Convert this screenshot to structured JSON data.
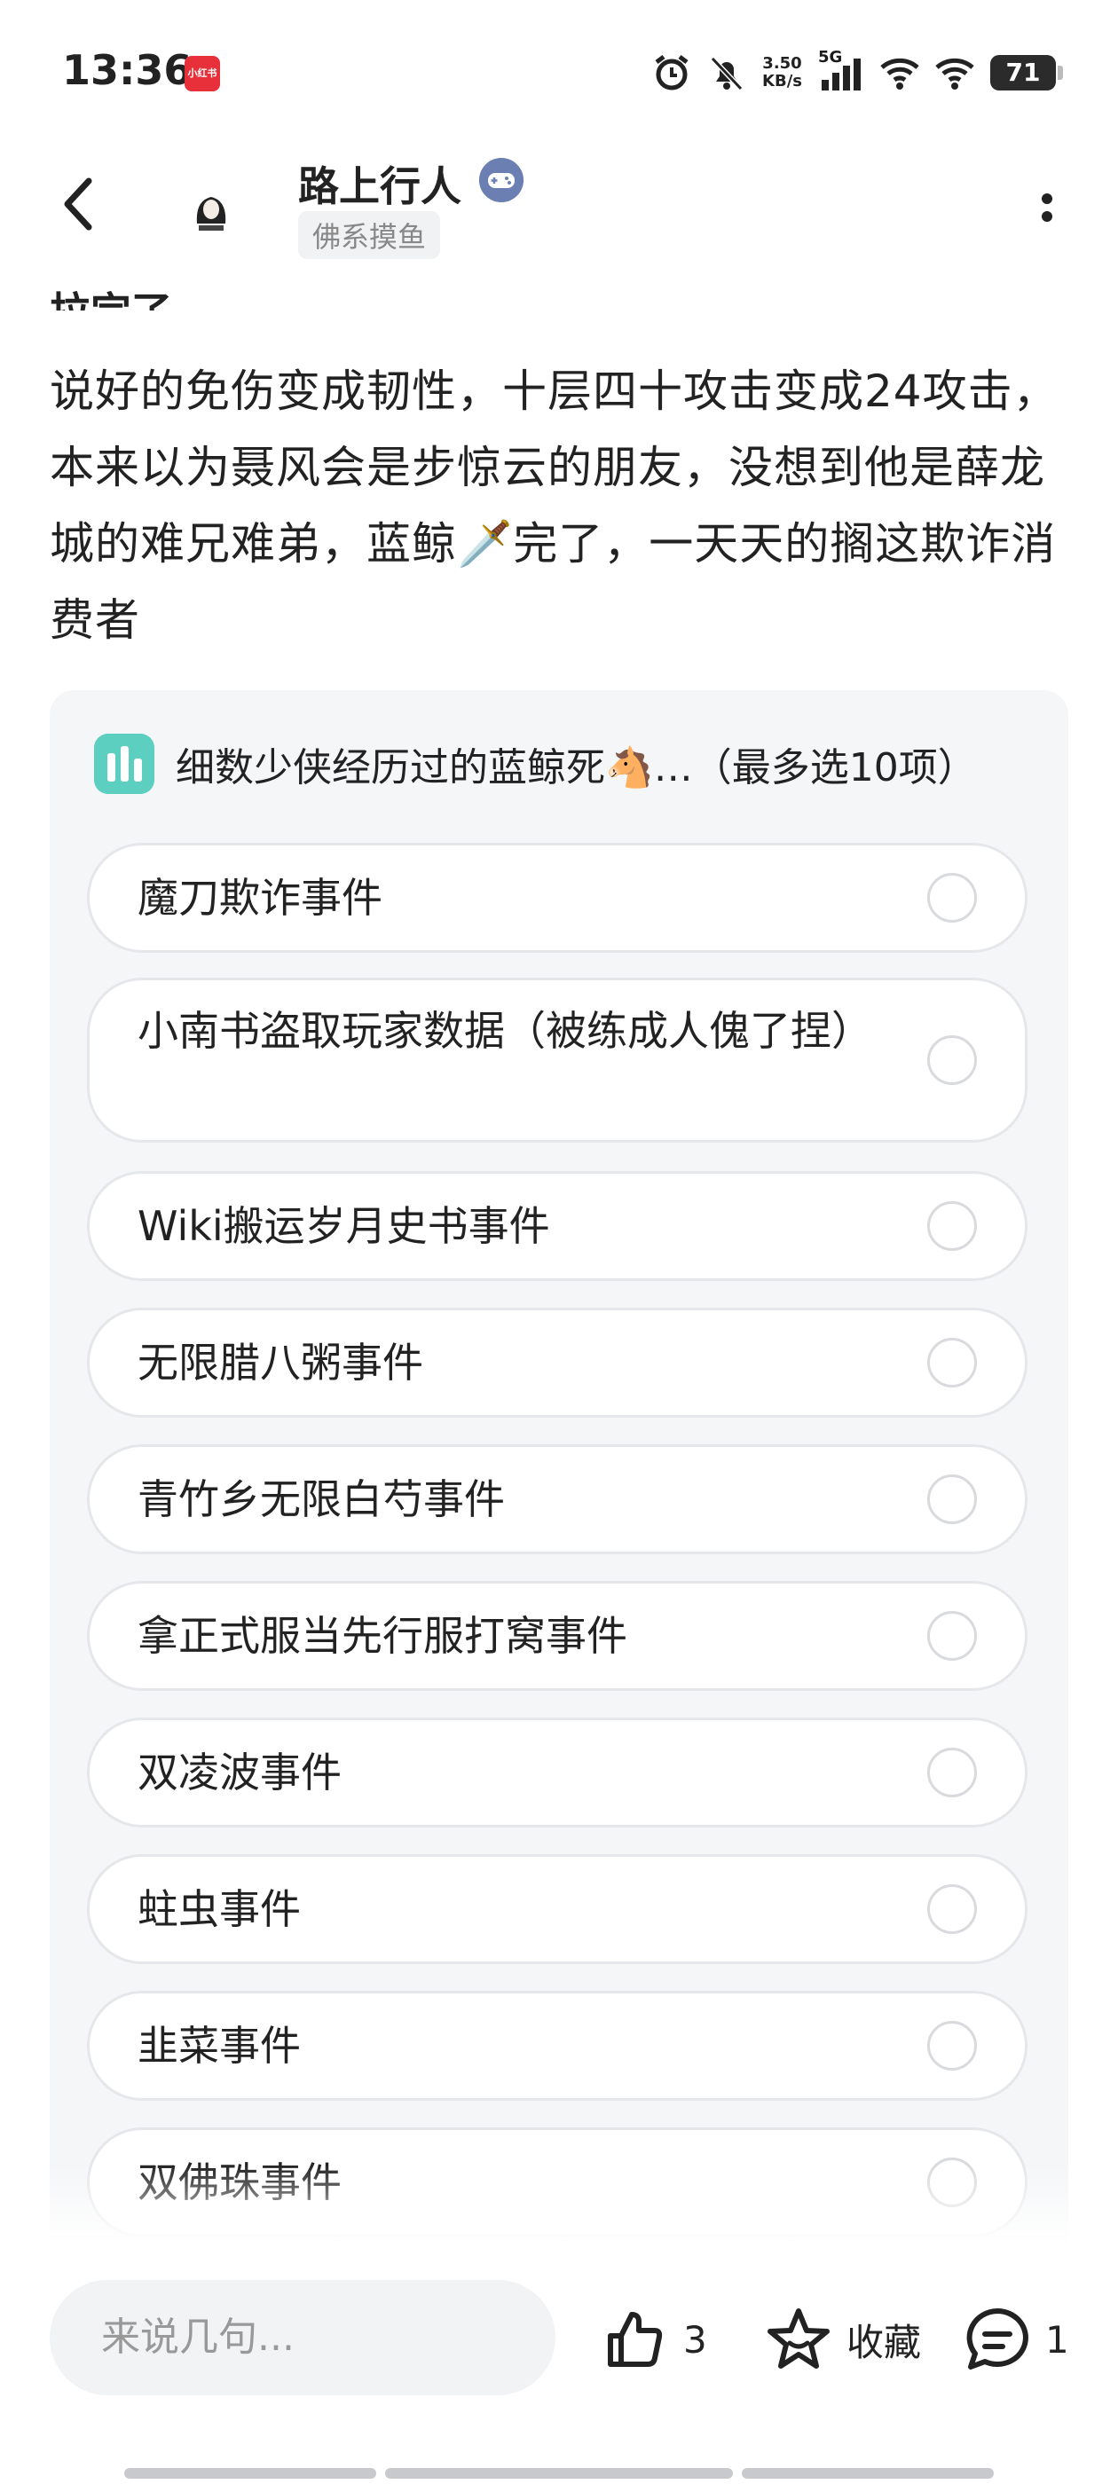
{
  "status_bar": {
    "time": "13:36",
    "app_badge": "小红书",
    "net_speed_value": "3.50",
    "net_speed_unit": "KB/s",
    "network": "5G",
    "battery": "71"
  },
  "header": {
    "username": "路上行人",
    "tag": "佛系摸鱼"
  },
  "post": {
    "cut_title": "拉完了",
    "body": "说好的免伤变成韧性，十层四十攻击变成24攻击，本来以为聂风会是步惊云的朋友，没想到他是薛龙城的难兄难弟，蓝鲸🗡️完了，一天天的搁这欺诈消费者"
  },
  "poll": {
    "title": "细数少侠经历过的蓝鲸死🐴…（最多选10项）",
    "options": [
      "魔刀欺诈事件",
      "小南书盗取玩家数据（被练成人傀了捏）",
      "Wiki搬运岁月史书事件",
      "无限腊八粥事件",
      "青竹乡无限白芍事件",
      "拿正式服当先行服打窝事件",
      "双凌波事件",
      "蛀虫事件",
      "韭菜事件",
      "双佛珠事件"
    ]
  },
  "bottom_bar": {
    "comment_placeholder": "来说几句...",
    "like_count": "3",
    "favorite_label": "收藏",
    "comment_count": "1"
  },
  "colors": {
    "poll_icon": "#5ccfc0",
    "poll_bg": "#f5f6f8",
    "game_badge": "#6b7fb3"
  },
  "icons": [
    "back-arrow-icon",
    "more-vertical-icon",
    "alarm-icon",
    "mute-icon",
    "signal-icon",
    "wifi-icon",
    "poll-bars-icon",
    "thumbs-up-icon",
    "star-icon",
    "comment-icon"
  ]
}
